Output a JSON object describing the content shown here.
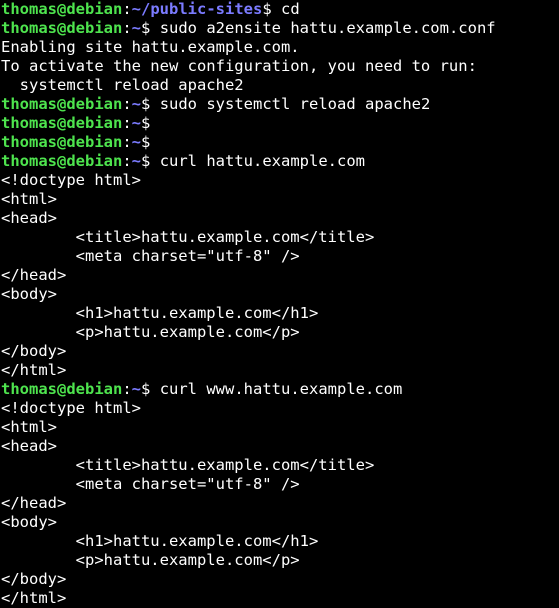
{
  "colors": {
    "background": "#000000",
    "user_host": "#4ee44e",
    "path": "#7b7bff",
    "text": "#ffffff"
  },
  "prompt": {
    "user_host": "thomas@debian",
    "colon": ":",
    "dollar": "$ "
  },
  "lines": [
    {
      "type": "prompt",
      "path": "~/public-sites",
      "command": "cd"
    },
    {
      "type": "prompt",
      "path": "~",
      "command": "sudo a2ensite hattu.example.com.conf"
    },
    {
      "type": "output",
      "text": "Enabling site hattu.example.com."
    },
    {
      "type": "output",
      "text": "To activate the new configuration, you need to run:"
    },
    {
      "type": "output",
      "text": "  systemctl reload apache2"
    },
    {
      "type": "prompt",
      "path": "~",
      "command": "sudo systemctl reload apache2"
    },
    {
      "type": "prompt",
      "path": "~",
      "command": ""
    },
    {
      "type": "prompt",
      "path": "~",
      "command": ""
    },
    {
      "type": "prompt",
      "path": "~",
      "command": "curl hattu.example.com"
    },
    {
      "type": "output",
      "text": "<!doctype html>"
    },
    {
      "type": "output",
      "text": "<html>"
    },
    {
      "type": "output",
      "text": "<head>"
    },
    {
      "type": "output",
      "text": "        <title>hattu.example.com</title>"
    },
    {
      "type": "output",
      "text": "        <meta charset=\"utf-8\" />"
    },
    {
      "type": "output",
      "text": "</head>"
    },
    {
      "type": "output",
      "text": "<body>"
    },
    {
      "type": "output",
      "text": "        <h1>hattu.example.com</h1>"
    },
    {
      "type": "output",
      "text": "        <p>hattu.example.com</p>"
    },
    {
      "type": "output",
      "text": "</body>"
    },
    {
      "type": "output",
      "text": "</html>"
    },
    {
      "type": "prompt",
      "path": "~",
      "command": "curl www.hattu.example.com"
    },
    {
      "type": "output",
      "text": "<!doctype html>"
    },
    {
      "type": "output",
      "text": "<html>"
    },
    {
      "type": "output",
      "text": "<head>"
    },
    {
      "type": "output",
      "text": "        <title>hattu.example.com</title>"
    },
    {
      "type": "output",
      "text": "        <meta charset=\"utf-8\" />"
    },
    {
      "type": "output",
      "text": "</head>"
    },
    {
      "type": "output",
      "text": "<body>"
    },
    {
      "type": "output",
      "text": "        <h1>hattu.example.com</h1>"
    },
    {
      "type": "output",
      "text": "        <p>hattu.example.com</p>"
    },
    {
      "type": "output",
      "text": "</body>"
    },
    {
      "type": "output",
      "text": "</html>"
    }
  ]
}
